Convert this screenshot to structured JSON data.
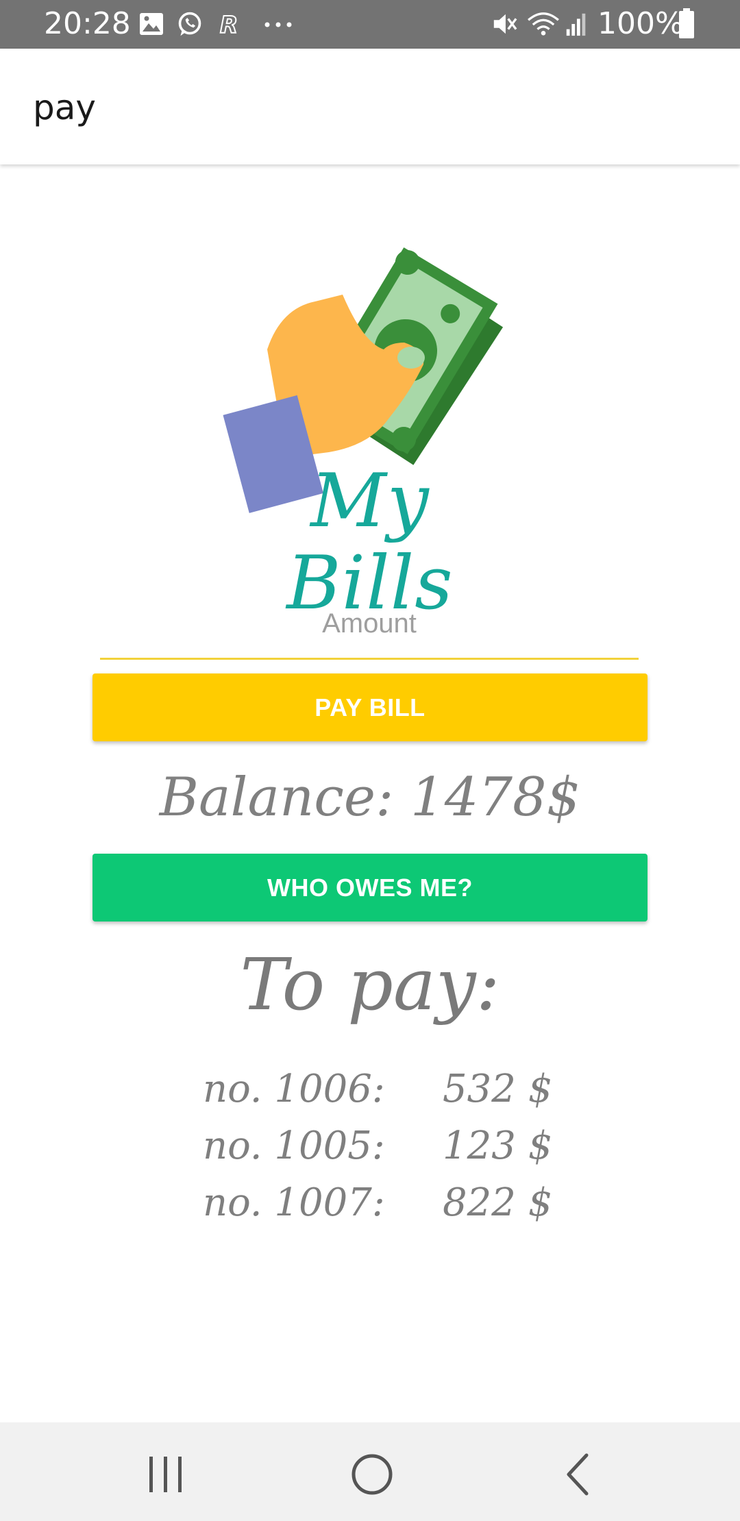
{
  "status_bar": {
    "time": "20:28",
    "battery": "100%",
    "left_icons": [
      "image-icon",
      "whatsapp-icon",
      "r-app-icon",
      "more-dots-icon"
    ],
    "right_icons": [
      "mute-icon",
      "wifi-icon",
      "signal-icon",
      "battery-icon"
    ]
  },
  "app_bar": {
    "title": "pay"
  },
  "logo": {
    "wordmark": "My Bills",
    "colors": {
      "bill_light": "#a8d8a8",
      "bill_dark": "#3a8f3a",
      "hand": "#fdb64c",
      "sleeve": "#7b86c8",
      "wordmark": "#16a89a"
    }
  },
  "amount": {
    "placeholder": "Amount",
    "value": ""
  },
  "buttons": {
    "pay_bill": "PAY BILL",
    "who_owes_me": "WHO OWES ME?"
  },
  "balance": {
    "text": "Balance: 1478$"
  },
  "to_pay": {
    "heading": "To pay:",
    "bills": [
      {
        "number": "no. 1006:",
        "amount": "532 $"
      },
      {
        "number": "no. 1005:",
        "amount": "123 $"
      },
      {
        "number": "no. 1007:",
        "amount": "822 $"
      }
    ]
  },
  "nav_bar": {
    "icons": [
      "recents-icon",
      "home-icon",
      "back-icon"
    ]
  },
  "colors": {
    "pay_button": "#ffcc00",
    "owes_button": "#0dc875",
    "input_underline": "#f2d23a",
    "status_bar": "#737373"
  }
}
